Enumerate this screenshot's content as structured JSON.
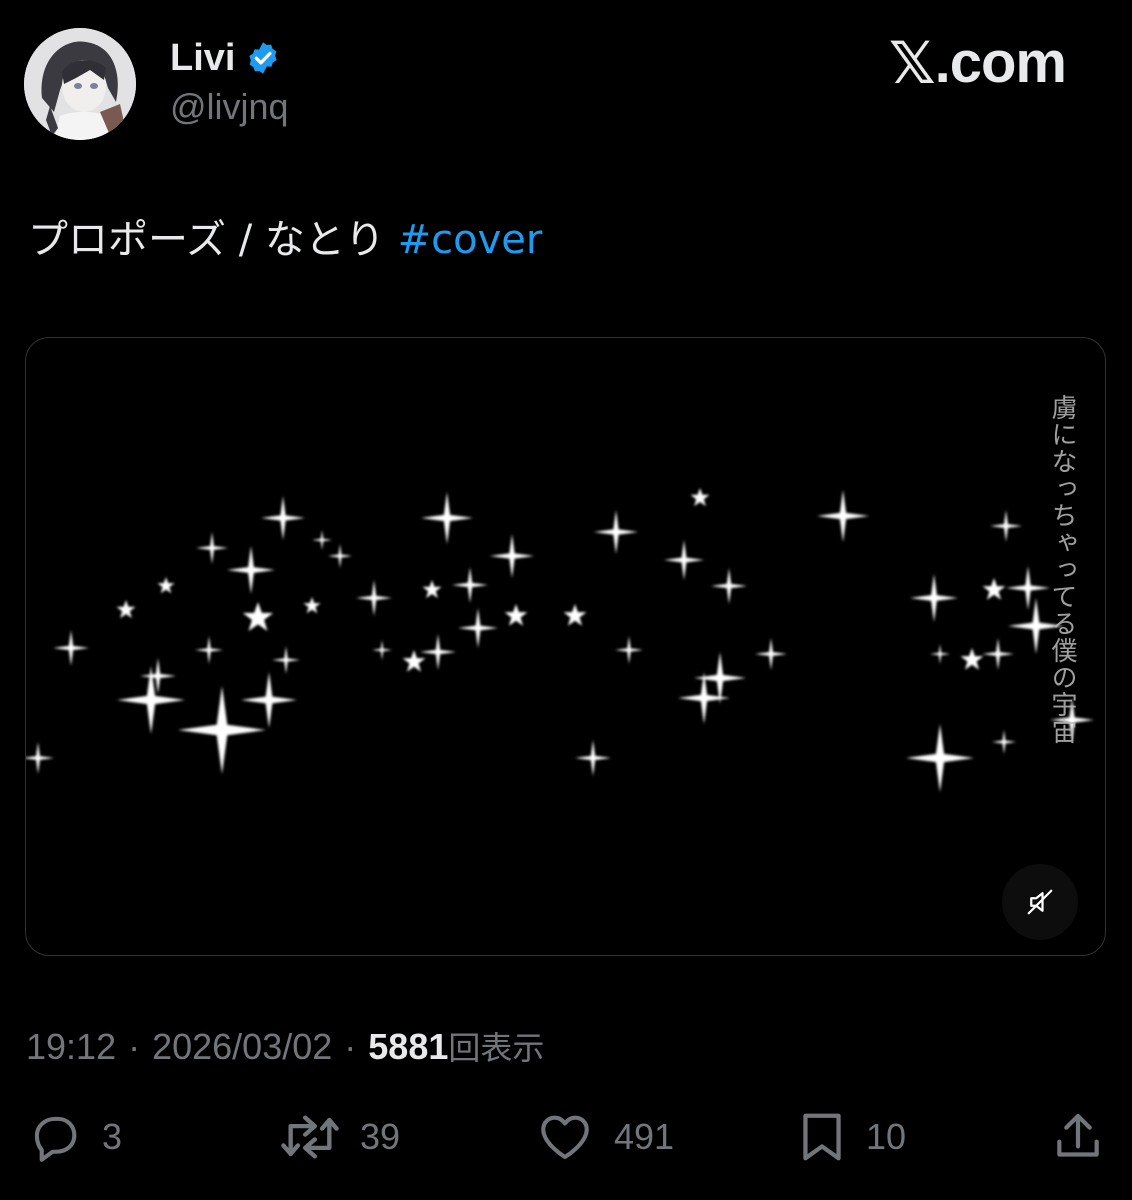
{
  "header": {
    "display_name": "Livi",
    "handle": "@livjnq",
    "verified_icon": "verified-badge-icon",
    "brand_x": "𝕏",
    "brand_suffix": ".com"
  },
  "tweet": {
    "text": "プロポーズ / なとり ",
    "hashtag": "#cover"
  },
  "media": {
    "lyric": "虜になっちゃってる僕の宇宙",
    "mute_icon": "speaker-muted-icon"
  },
  "meta": {
    "time": "19:12",
    "date": "2026/03/02",
    "views": "5881",
    "views_label": "回表示",
    "separator": "·"
  },
  "actions": {
    "replies": "3",
    "reposts": "39",
    "likes": "491",
    "bookmarks": "10"
  },
  "colors": {
    "background": "#000000",
    "text": "#e7e9ea",
    "muted": "#71767b",
    "accent": "#1d9bf0"
  }
}
